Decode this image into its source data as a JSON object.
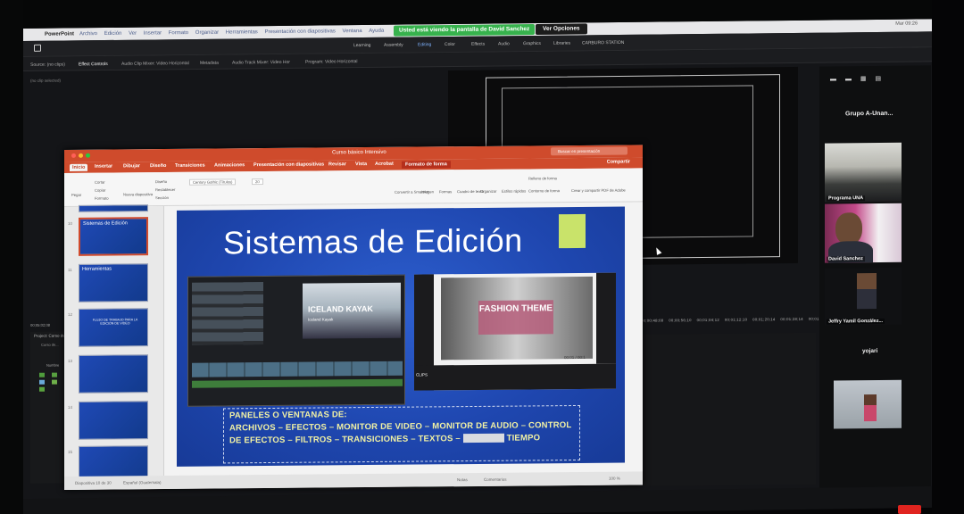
{
  "macbar": {
    "app": "PowerPoint",
    "menus": [
      "Archivo",
      "Edición",
      "Ver",
      "Insertar",
      "Formato",
      "Organizar",
      "Herramientas",
      "Presentación con diapositivas",
      "Ventana",
      "Ayuda"
    ],
    "share_banner": "Usted está viendo la pantalla de David Sanchez",
    "view_options": "Ver Opciones",
    "clock": "Mar 09:26"
  },
  "premiere": {
    "workspaces": [
      "Learning",
      "Assembly",
      "Editing",
      "Color",
      "Effects",
      "Audio",
      "Graphics",
      "Libraries",
      "CARBURO STATION"
    ],
    "panels": [
      "Source: (no clips)",
      "Effect Controls",
      "Audio Clip Mixer: Video Horizontal",
      "Metadata",
      "Audio Track Mixer: Video Hor",
      "Program: Video Horizontal"
    ],
    "no_clip": "(no clip selected)",
    "project": "Project: Curso de ...",
    "curso": "Curso de...",
    "nombre": "Nombre",
    "timecodes": [
      "00;00;48;08",
      "00;00;56;10",
      "00;01;04;12",
      "00;01;12;10",
      "00;01;20;14",
      "00;01;28;14",
      "00;01;36;16"
    ],
    "timecode_left": "00;05;02;08"
  },
  "ppt": {
    "doc_title": "Curso básico Intensivo",
    "search_placeholder": "Buscar en presentación",
    "tabs": [
      "Inicio",
      "Insertar",
      "Dibujar",
      "Diseño",
      "Transiciones",
      "Animaciones",
      "Presentación con diapositivas",
      "Revisar",
      "Vista",
      "Acrobat",
      "Formato de forma"
    ],
    "share": "Compartir",
    "ribbon": [
      "Pegar",
      "Cortar",
      "Copiar",
      "Formato",
      "Nueva diapositiva",
      "Diseño",
      "Restablecer",
      "Sección",
      "Century Gothic (Títulos)",
      "20",
      "Convertir a SmartArt",
      "Imagen",
      "Formas",
      "Cuadro de texto",
      "Organizar",
      "Estilos rápidos",
      "Relleno de forma",
      "Contorno de forma",
      "Crear y compartir PDF de Adobe"
    ],
    "thumbs": [
      {
        "n": "",
        "t": ""
      },
      {
        "n": "10",
        "t": "Sistemas de Edición"
      },
      {
        "n": "11",
        "t": "Herramientas"
      },
      {
        "n": "12",
        "t": "FLUJO DE TRABAJO PARA LA EDICIÓN DE VIDEO"
      },
      {
        "n": "13",
        "t": ""
      },
      {
        "n": "14",
        "t": ""
      },
      {
        "n": "15",
        "t": ""
      }
    ],
    "slide": {
      "title": "Sistemas de Edición",
      "body_line1": "PANELES O VENTANAS DE:",
      "body_line2": "ARCHIVOS – EFECTOS – MONITOR DE VIDEO – MONITOR DE AUDIO – CONTROL",
      "body_line3": "DE EFECTOS – FILTROS – TRANSICIONES – TEXTOS –",
      "body_line3_end": "TIEMPO",
      "img1_label": "ICELAND KAYAK",
      "img1_sub": "Iceland Kayak",
      "img2_label": "FASHION THEME",
      "img2_time": "00:01 / 00:1",
      "clips": "CLIPS"
    },
    "status": [
      "Diapositiva 10 de 30",
      "Español (Guatemala)",
      "Notas",
      "Comentarios",
      "100 %"
    ]
  },
  "zoom": {
    "group": "Grupo A-Unan...",
    "participants": [
      "Programa UNA",
      "David Sanchez",
      "Jeffry Yamil González...",
      "yojari"
    ]
  },
  "colors": {
    "ppt_accent": "#cf4b2c",
    "share_green": "#37b24d",
    "slide_blue": "#1f47b0",
    "slide_text_yellow": "#f1f1a4",
    "slide_accent_green": "#c9e36a"
  }
}
